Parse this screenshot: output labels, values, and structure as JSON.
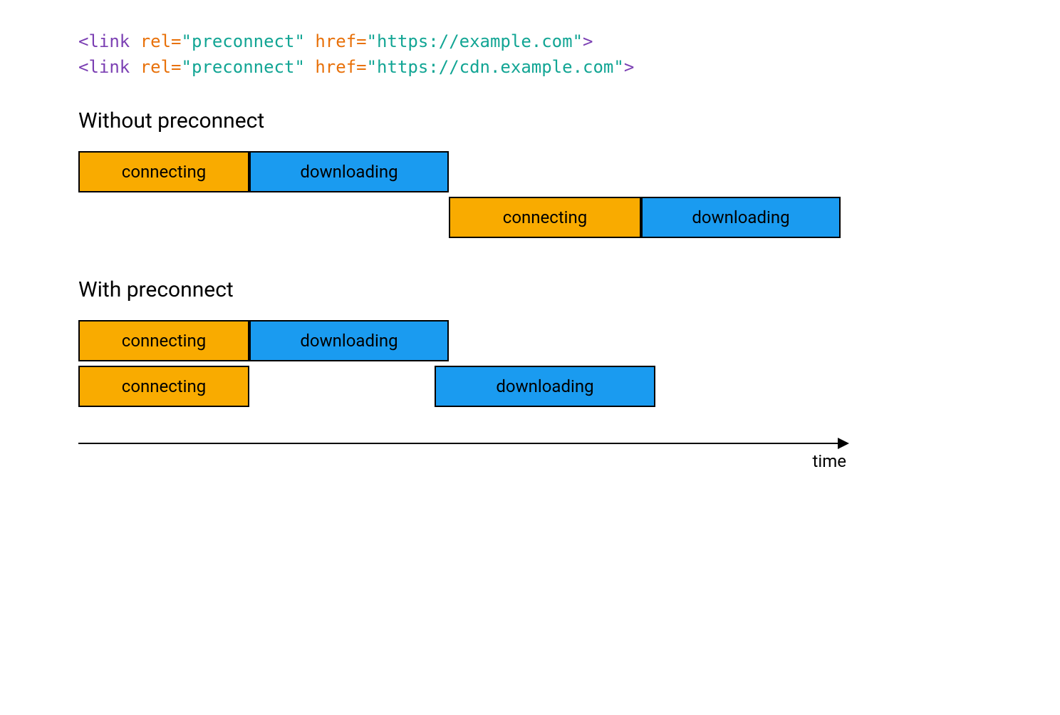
{
  "code": {
    "line1": {
      "open": "<link ",
      "attr1_name": "rel=",
      "attr1_val": "\"preconnect\" ",
      "attr2_name": "href=",
      "attr2_val": "\"https://example.com\"",
      "close": ">"
    },
    "line2": {
      "open": "<link ",
      "attr1_name": "rel=",
      "attr1_val": "\"preconnect\" ",
      "attr2_name": "href=",
      "attr2_val": "\"https://cdn.example.com\"",
      "close": ">"
    }
  },
  "sections": {
    "without": {
      "heading": "Without preconnect"
    },
    "with": {
      "heading": "With preconnect"
    }
  },
  "labels": {
    "connecting": "connecting",
    "downloading": "downloading",
    "time": "time"
  },
  "chart_data": {
    "type": "bar",
    "xlabel": "time",
    "scenarios": [
      {
        "name": "Without preconnect",
        "tracks": [
          [
            {
              "phase": "connecting",
              "start": 0,
              "end": 240,
              "color": "#f9ab00"
            },
            {
              "phase": "downloading",
              "start": 240,
              "end": 520,
              "color": "#1a9bf0"
            }
          ],
          [
            {
              "phase": "connecting",
              "start": 520,
              "end": 790,
              "color": "#f9ab00"
            },
            {
              "phase": "downloading",
              "start": 790,
              "end": 1070,
              "color": "#1a9bf0"
            }
          ]
        ]
      },
      {
        "name": "With preconnect",
        "tracks": [
          [
            {
              "phase": "connecting",
              "start": 0,
              "end": 240,
              "color": "#f9ab00"
            },
            {
              "phase": "downloading",
              "start": 240,
              "end": 520,
              "color": "#1a9bf0"
            }
          ],
          [
            {
              "phase": "connecting",
              "start": 0,
              "end": 240,
              "color": "#f9ab00"
            },
            {
              "phase": "downloading",
              "start": 500,
              "end": 810,
              "color": "#1a9bf0"
            }
          ]
        ]
      }
    ]
  }
}
